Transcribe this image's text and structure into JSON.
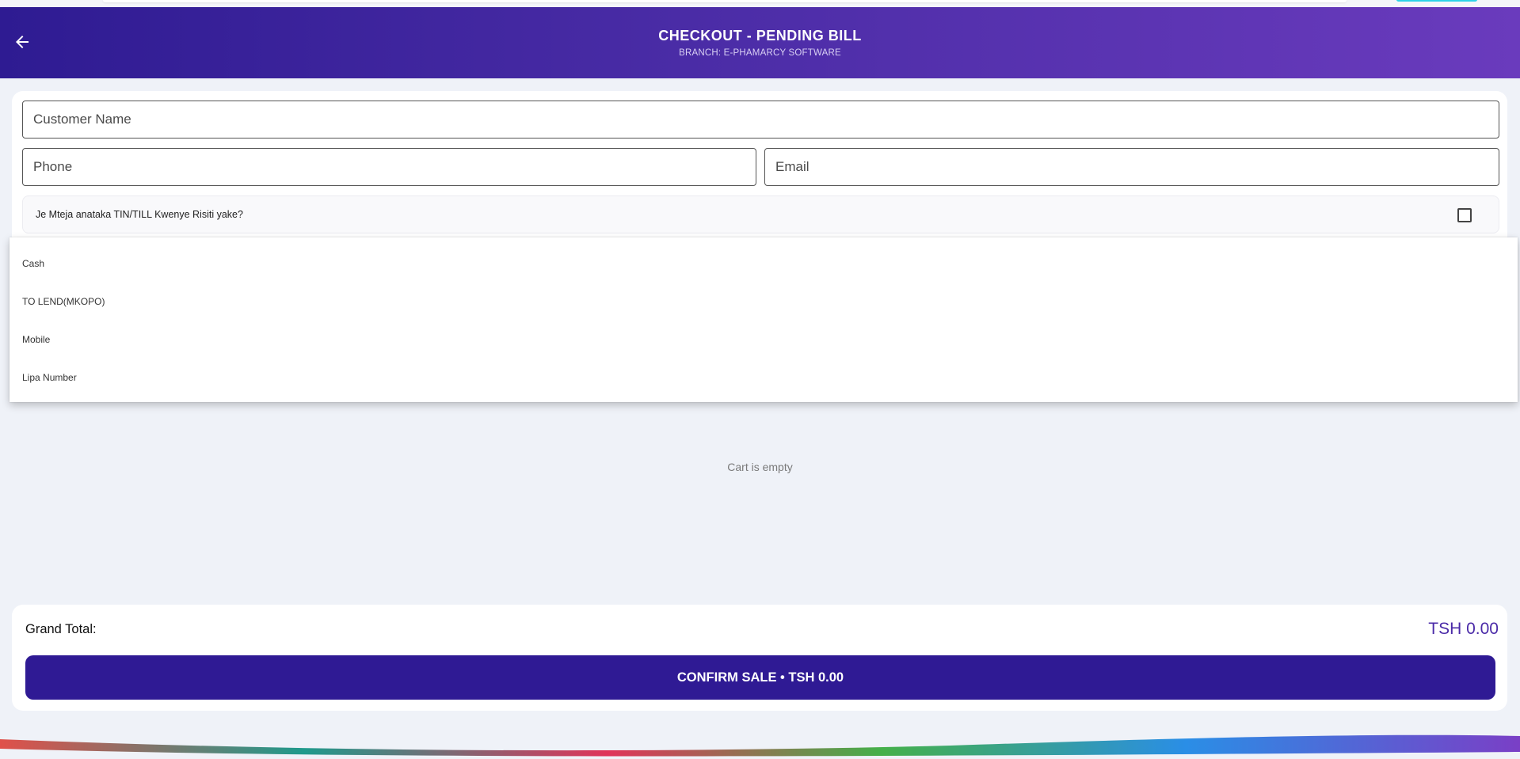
{
  "header": {
    "title": "CHECKOUT - PENDING BILL",
    "subtitle": "BRANCH: E-PHAMARCY SOFTWARE"
  },
  "form": {
    "customer_name_placeholder": "Customer Name",
    "phone_placeholder": "Phone",
    "email_placeholder": "Email",
    "tin_question": "Je Mteja anataka TIN/TILL Kwenye Risiti yake?",
    "tin_checked": false
  },
  "payment_options": [
    "Cash",
    "TO LEND(MKOPO)",
    "Mobile",
    "Lipa Number"
  ],
  "cart": {
    "empty_message": "Cart is empty"
  },
  "summary": {
    "grand_total_label": "Grand Total:",
    "grand_total_value": "TSH 0.00",
    "confirm_label": "CONFIRM SALE  •  TSH 0.00"
  },
  "colors": {
    "header_start": "#2e1b92",
    "header_end": "#6a3bbd",
    "accent": "#4b2ba8",
    "confirm_bg": "#2f1a94"
  }
}
